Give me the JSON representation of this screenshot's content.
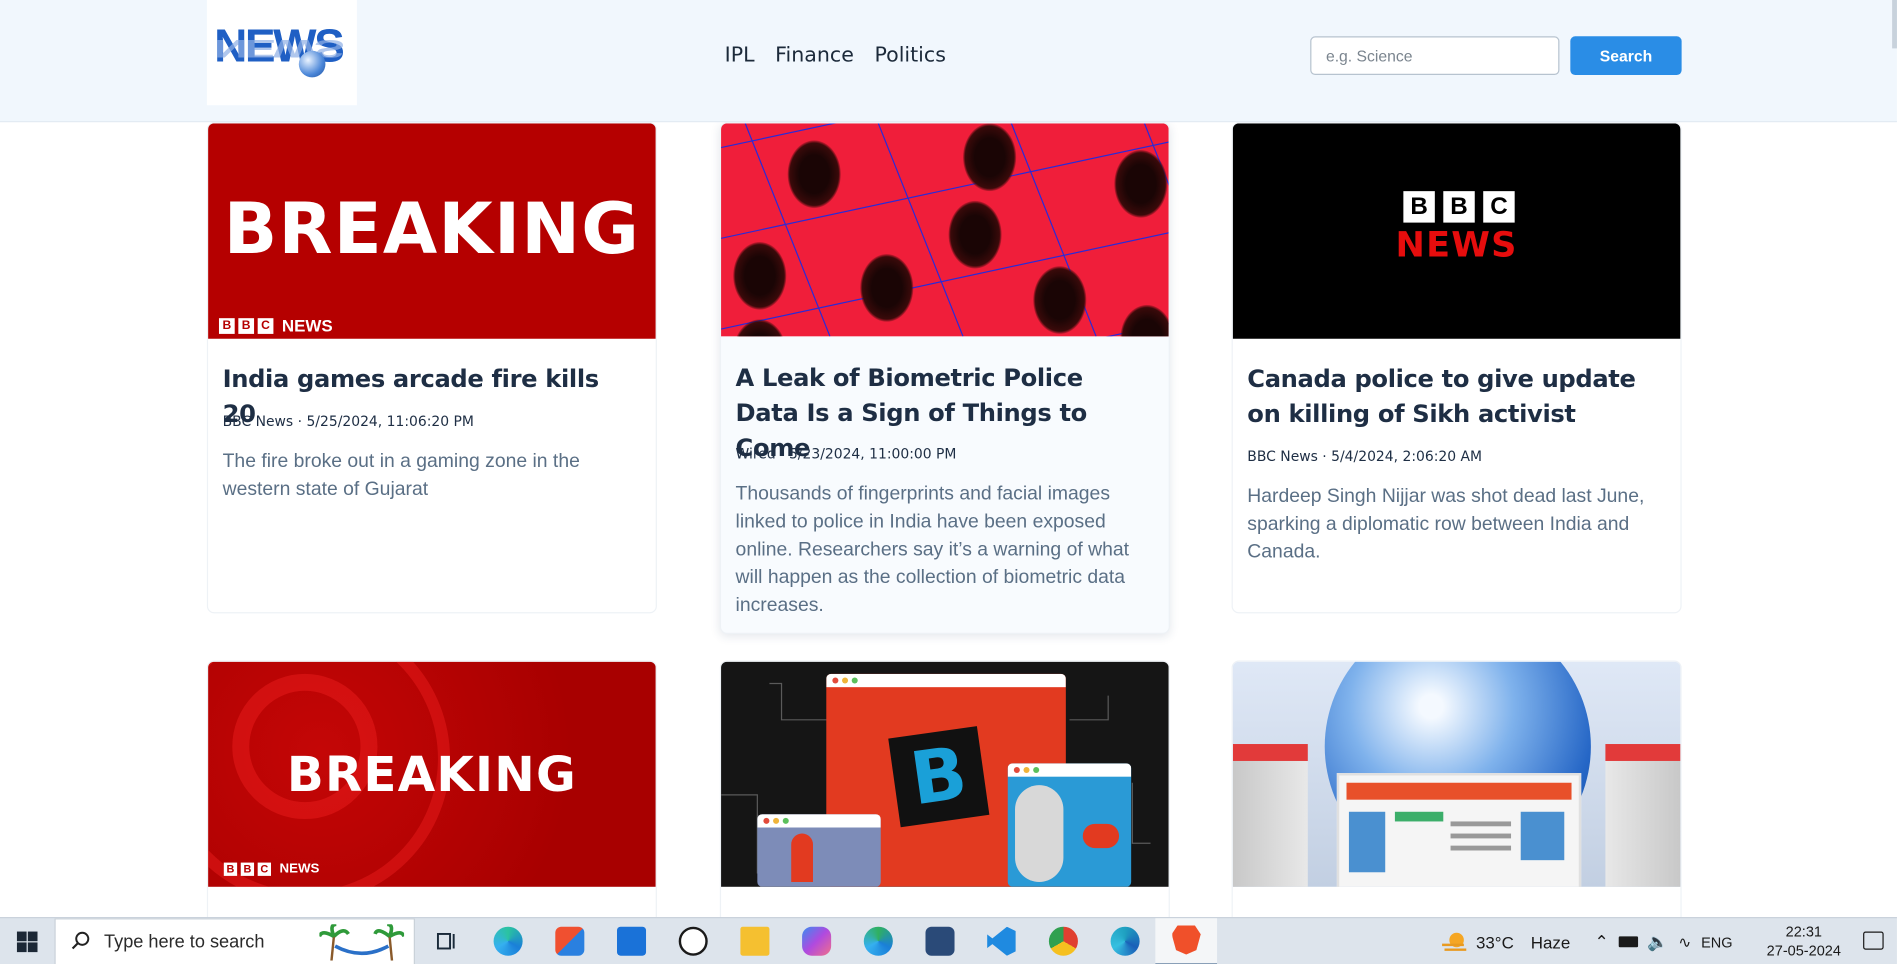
{
  "header": {
    "logo_text": "NEWS",
    "nav": [
      "IPL",
      "Finance",
      "Politics"
    ],
    "search_placeholder": "e.g. Science",
    "search_button": "Search"
  },
  "cards": [
    {
      "image_text": "BREAKING",
      "image_badge": "NEWS",
      "title": "India games arcade fire kills 20",
      "meta": "BBC News · 5/25/2024, 11:06:20 PM",
      "description": "The fire broke out in a gaming zone in the western state of Gujarat"
    },
    {
      "title": "A Leak of Biometric Police Data Is a Sign of Things to Come",
      "meta": "Wired · 5/23/2024, 11:00:00 PM",
      "description": "Thousands of fingerprints and facial images linked to police in India have been exposed online. Researchers say it’s a warning of what will happen as the collection of biometric data increases."
    },
    {
      "image_text": "NEWS",
      "title": "Canada police to give update on killing of Sikh activist",
      "meta": "BBC News · 5/4/2024, 2:06:20 AM",
      "description": "Hardeep Singh Nijjar was shot dead last June, sparking a diplomatic row between India and Canada."
    },
    {
      "image_text": "BREAKING",
      "image_badge": "NEWS"
    },
    {
      "image_letter": "B"
    },
    {}
  ],
  "bbc_letters": [
    "B",
    "B",
    "C"
  ],
  "taskbar": {
    "search_text": "Type here to search",
    "weather_temp": "33°C",
    "weather_cond": "Haze",
    "language": "ENG",
    "time": "22:31",
    "date": "27-05-2024",
    "apps": [
      "task-view-icon",
      "edge-icon",
      "store-icon",
      "mail-icon",
      "dell-icon",
      "file-explorer-icon",
      "copilot-icon",
      "edge-dev-icon",
      "ssms-icon",
      "vscode-icon",
      "chrome-icon",
      "edge-beta-icon",
      "brave-icon"
    ]
  },
  "colors": {
    "header_bg": "#f1f7fd",
    "search_button": "#2a8de6",
    "title": "#1e2e44",
    "description": "#5a6f85",
    "bbc_red": "#b50000"
  }
}
